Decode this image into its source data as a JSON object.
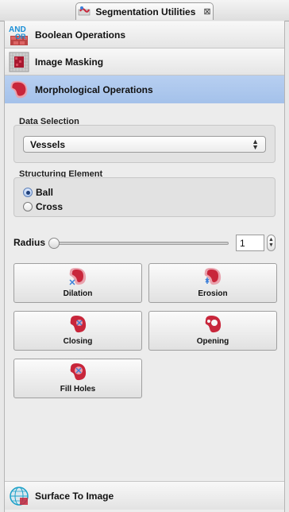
{
  "window": {
    "tab_title": "Segmentation Utilities",
    "tab_close": "⊠"
  },
  "sections": {
    "boolean": {
      "label": "Boolean Operations",
      "icon_text": "AND OR"
    },
    "masking": {
      "label": "Image Masking"
    },
    "morph": {
      "label": "Morphological Operations"
    },
    "surface": {
      "label": "Surface To Image"
    }
  },
  "data_selection": {
    "label": "Data Selection",
    "value": "Vessels"
  },
  "structuring_element": {
    "label": "Structuring Element",
    "options": [
      {
        "label": "Ball",
        "selected": true
      },
      {
        "label": "Cross",
        "selected": false
      }
    ]
  },
  "radius": {
    "label": "Radius",
    "value": "1",
    "slider_fraction": 0
  },
  "operations": {
    "dilation": "Dilation",
    "erosion": "Erosion",
    "closing": "Closing",
    "opening": "Opening",
    "fill_holes": "Fill Holes"
  },
  "colors": {
    "accent_header": "#a9c4ec",
    "shape_red": "#c8263b",
    "shape_pink": "#e9a2ad",
    "marker_blue": "#3b7fd9"
  }
}
